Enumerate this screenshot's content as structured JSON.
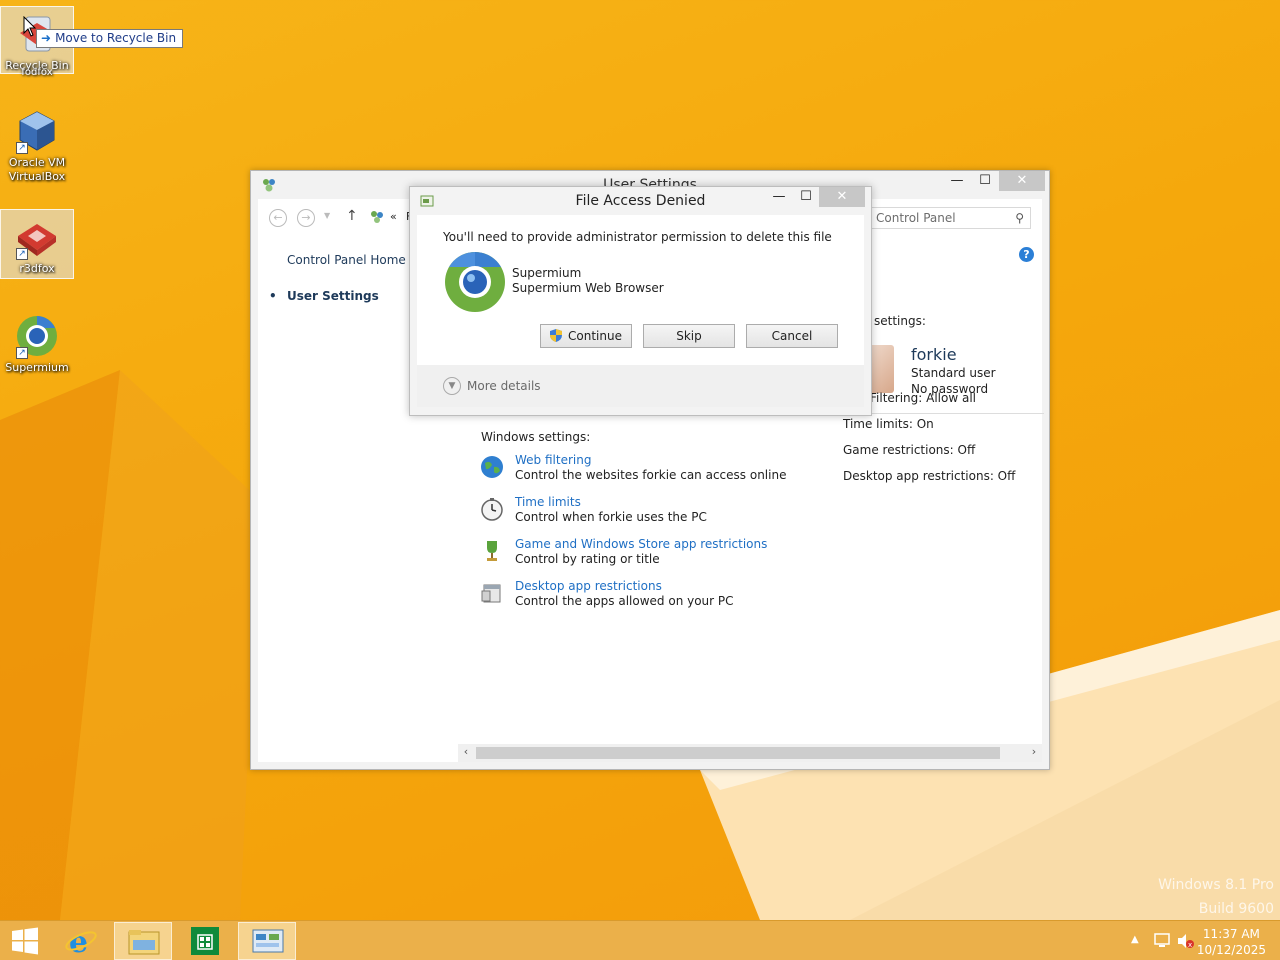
{
  "desktop": {
    "icons": [
      {
        "label": "Recycle Bin",
        "overlap_label": "fodfox"
      },
      {
        "label": "Oracle VM VirtualBox"
      },
      {
        "label": "r3dfox"
      },
      {
        "label": "Supermium"
      }
    ],
    "drag_tooltip": "Move to Recycle Bin",
    "watermark_line1": "Windows 8.1 Pro",
    "watermark_line2": "Build 9600"
  },
  "main_window": {
    "title": "User Settings",
    "address_sep": "«",
    "address_partial": "F",
    "search_placeholder": "Control Panel",
    "left_nav": {
      "home": "Control Panel Home",
      "current": "User Settings"
    },
    "settings_head": "settings:",
    "user": {
      "name": "forkie",
      "type": "Standard user",
      "password": "No password"
    },
    "status": [
      {
        "text": "Filtering: Allow all"
      },
      {
        "text": "Time limits: On"
      },
      {
        "text": "Game restrictions: Off"
      },
      {
        "text": "Desktop app restrictions: Off"
      }
    ],
    "windows_settings_head": "Windows settings:",
    "windows_settings": [
      {
        "link": "Web filtering",
        "desc": "Control the websites forkie can access online",
        "icon": "globe-icon"
      },
      {
        "link": "Time limits",
        "desc": "Control when forkie uses the PC",
        "icon": "clock-icon"
      },
      {
        "link": "Game and Windows Store app restrictions",
        "desc": "Control by rating or title",
        "icon": "trophy-icon"
      },
      {
        "link": "Desktop app restrictions",
        "desc": "Control the apps allowed on your PC",
        "icon": "app-window-icon"
      }
    ]
  },
  "dialog": {
    "title": "File Access Denied",
    "message": "You'll need to provide administrator permission to delete this file",
    "app_name": "Supermium",
    "app_desc": "Supermium Web Browser",
    "buttons": {
      "continue": "Continue",
      "skip": "Skip",
      "cancel": "Cancel"
    },
    "more_details": "More details"
  },
  "taskbar": {
    "time": "11:37 AM",
    "date": "10/12/2025"
  },
  "colors": {
    "accent_link": "#1f6fc4",
    "wallpaper": "#f5a80c",
    "taskbar": "#ebb04a"
  }
}
